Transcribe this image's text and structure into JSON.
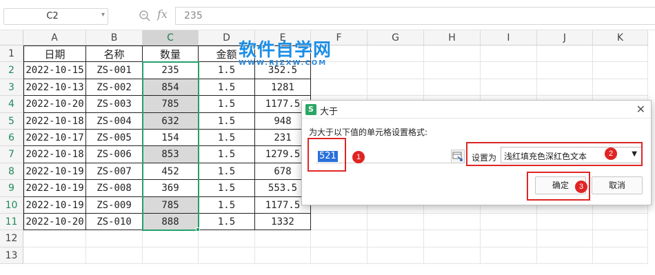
{
  "formula_bar": {
    "name_box": "C2",
    "fx_label": "fx",
    "formula_value": "235"
  },
  "sheet": {
    "columns": [
      "A",
      "B",
      "C",
      "D",
      "E",
      "F",
      "G",
      "H",
      "I",
      "J",
      "K"
    ],
    "rows": [
      "1",
      "2",
      "3",
      "4",
      "5",
      "6",
      "7",
      "8",
      "9",
      "10",
      "11",
      "12",
      "13"
    ],
    "header_row": [
      "日期",
      "名称",
      "数量",
      "金额",
      ""
    ],
    "data": [
      [
        "2022-10-15",
        "ZS-001",
        "235",
        "1.5",
        "352.5"
      ],
      [
        "2022-10-13",
        "ZS-002",
        "854",
        "1.5",
        "1281"
      ],
      [
        "2022-10-20",
        "ZS-003",
        "785",
        "1.5",
        "1177.5"
      ],
      [
        "2022-10-18",
        "ZS-004",
        "632",
        "1.5",
        "948"
      ],
      [
        "2022-10-17",
        "ZS-005",
        "154",
        "1.5",
        "231"
      ],
      [
        "2022-10-18",
        "ZS-006",
        "853",
        "1.5",
        "1279.5"
      ],
      [
        "2022-10-19",
        "ZS-007",
        "452",
        "1.5",
        "678"
      ],
      [
        "2022-10-19",
        "ZS-008",
        "369",
        "1.5",
        "553.5"
      ],
      [
        "2022-10-19",
        "ZS-009",
        "785",
        "1.5",
        "1177.5"
      ],
      [
        "2022-10-20",
        "ZS-010",
        "888",
        "1.5",
        "1332"
      ]
    ],
    "highlighted_quantities": [
      "854",
      "785",
      "632",
      "853",
      "785",
      "888"
    ]
  },
  "watermark": {
    "title": "软件自学网",
    "url": "WWW.RJZXW.COM"
  },
  "dialog": {
    "logo": "S",
    "title": "大于",
    "close": "✕",
    "prompt": "为大于以下值的单元格设置格式:",
    "value": "521",
    "set_as_label": "设置为",
    "format_option": "浅红填充色深红色文本",
    "ok_label": "确定",
    "cancel_label": "取消"
  },
  "annotations": [
    "1",
    "2",
    "3"
  ],
  "colors": {
    "selection_border": "#22a06b",
    "highlight_fill": "#d9d9d9",
    "annotation_red": "#e02424",
    "watermark_blue": "#1b8ee6"
  }
}
